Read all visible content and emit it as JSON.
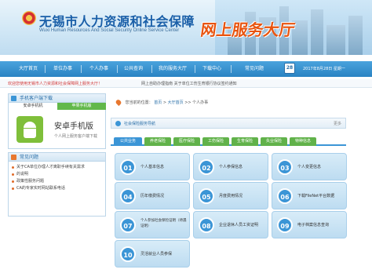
{
  "header": {
    "title": "无锡市人力资源和社会保障",
    "subtitle": "Wuxi Human Resources And Social Security Online Service Center",
    "badge": "网上服务大厅"
  },
  "nav": {
    "items": [
      "大厅首页",
      "单位办事",
      "个人办事",
      "公共查询",
      "我的服务大厅",
      "下载中心",
      "常见问题"
    ],
    "calendar_day": "28",
    "date_text": "2017年8月28日 星期一"
  },
  "ticker": {
    "text1": "欢迎您使用无锡市人力资源和社会保障网上服务大厅！",
    "text2": "网上自助办理指南    关于单位工伤生育银行协议签约通知"
  },
  "sidebar": {
    "mobile_title": "手机客户端下载",
    "tab_ios": "安卓手机机",
    "tab_android": "苹果手机版",
    "android_title": "安卓手机版",
    "android_sub": "个人网上服务客户端下载",
    "faq_title": "常见问题",
    "faq_items": [
      "关于CA单位办理人才离职手续有关需求",
      "的说明",
      "政策性服务问题",
      "CA的专家实时网站联系电话"
    ]
  },
  "breadcrumb": {
    "prefix": "您当前的位置：",
    "home": "首页",
    "sep1": " > ",
    "link": "大厅首页",
    "rest": " >> 个人办事"
  },
  "service": {
    "title": "社会保险服务导航",
    "more": "更多",
    "categories": [
      "公共业务",
      "养老保险",
      "医疗保险",
      "工伤保险",
      "生育保险",
      "失业保险",
      "特种信息"
    ],
    "tiles": [
      {
        "num": "01",
        "label": "个人基本信息"
      },
      {
        "num": "02",
        "label": "个人参保信息"
      },
      {
        "num": "03",
        "label": "个人变更信息"
      },
      {
        "num": "04",
        "label": "历年缴费情况"
      },
      {
        "num": "05",
        "label": "月度费用情况"
      },
      {
        "num": "06",
        "label": "下载FileNet平台数据"
      },
      {
        "num": "07",
        "label": "个人参加社会保险证明（待遇证明）"
      },
      {
        "num": "08",
        "label": "企业退休人员工资证明"
      },
      {
        "num": "09",
        "label": "电子档案信息查询"
      },
      {
        "num": "10",
        "label": "灵活就业人员参保"
      }
    ]
  },
  "colors": {
    "primary": "#3b95d6",
    "accent": "#e8540f",
    "green": "#61b24a"
  }
}
